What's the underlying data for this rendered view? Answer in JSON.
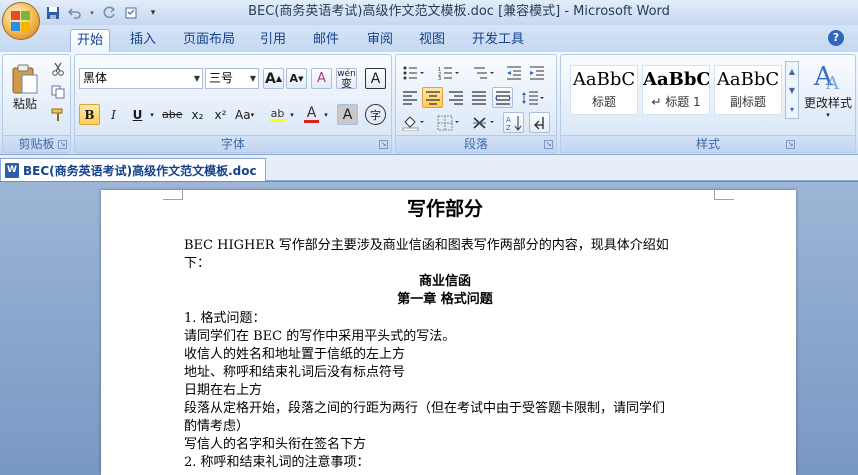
{
  "window": {
    "title": "BEC(商务英语考试)高级作文范文模板.doc [兼容模式] - Microsoft Word"
  },
  "quick_access": {
    "save_icon": "save-icon",
    "undo_icon": "undo-icon",
    "redo_icon": "redo-icon",
    "customize_icon": "dropdown-icon"
  },
  "tabs": [
    "开始",
    "插入",
    "页面布局",
    "引用",
    "邮件",
    "审阅",
    "视图",
    "开发工具"
  ],
  "ribbon": {
    "clipboard": {
      "label": "剪贴板",
      "paste_label": "粘贴"
    },
    "font": {
      "label": "字体",
      "font_name": "黑体",
      "font_size": "三号",
      "grow": "A",
      "shrink": "A",
      "clear": "A",
      "pinyin": "wén",
      "border_char": "A",
      "bold": "B",
      "italic": "I",
      "underline": "U",
      "strike": "abe",
      "sub": "x₂",
      "sup": "x²",
      "case": "Aa",
      "highlight": "ab",
      "color": "A",
      "shade": "A",
      "enclose": "字"
    },
    "paragraph": {
      "label": "段落"
    },
    "styles": {
      "label": "样式",
      "items": [
        {
          "preview": "AaBbC",
          "name": "标题"
        },
        {
          "preview": "AaBbC",
          "name": "↵ 标题 1"
        },
        {
          "preview": "AaBbC",
          "name": "副标题"
        }
      ],
      "change_label": "更改样式"
    }
  },
  "document_tab": {
    "label": "BEC(商务英语考试)高级作文范文模板.doc"
  },
  "document": {
    "title": "写作部分",
    "intro_line1": "BEC HIGHER 写作部分主要涉及商业信函和图表写作两部分的内容，现具体介绍如",
    "intro_line2": "下：",
    "section": "商业信函",
    "chapter": "第一章 格式问题",
    "lines": [
      "1. 格式问题：",
      "请同学们在 BEC 的写作中采用平头式的写法。",
      "收信人的姓名和地址置于信纸的左上方",
      "地址、称呼和结束礼词后没有标点符号",
      "日期在右上方",
      "段落从定格开始，段落之间的行距为两行（但在考试中由于受答题卡限制，请同学们",
      "酌情考虑）",
      "写信人的名字和头衔在签名下方",
      "2. 称呼和结束礼词的注意事项："
    ]
  }
}
